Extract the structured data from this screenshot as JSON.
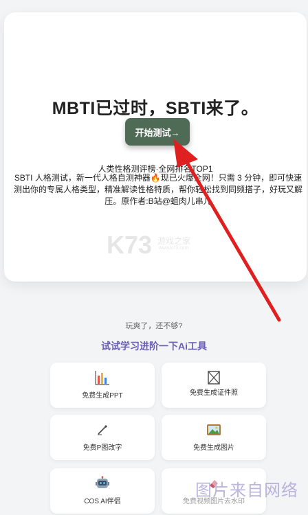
{
  "hero": {
    "title": "MBTI已过时，SBTI来了。",
    "start_button": "开始测试→",
    "subtitle": "人类性格测评榜·全网排名TOP1",
    "description": "SBTI 人格测试，新一代人格自测神器🔥现已火爆全网！只需 3 分钟，即可快速测出你的专属人格类型，精准解读性格特质，帮你轻松找到同频搭子，好玩又解压。原作者:B站@蛆肉儿串儿"
  },
  "watermark": {
    "logo": "K73",
    "site_name": "游戏之家",
    "url": "www.k73.com"
  },
  "more": {
    "hint": "玩爽了，还不够?",
    "title": "试试学习进阶一下Ai工具"
  },
  "tools": [
    {
      "label": "免费生成PPT",
      "icon": "bar-chart-icon"
    },
    {
      "label": "免费生成证件照",
      "icon": "id-photo-icon"
    },
    {
      "label": "免费P图改字",
      "icon": "pen-edit-icon"
    },
    {
      "label": "免费生成图片",
      "icon": "picture-icon"
    },
    {
      "label": "COS AI伴侣",
      "icon": "robot-icon"
    },
    {
      "label": "免费视频图片去水印",
      "icon": "eraser-icon"
    }
  ],
  "corner_watermark": "图片来自网络",
  "colors": {
    "button_bg": "#4f6b56",
    "section_title": "#6a5db8",
    "arrow": "#e02020"
  }
}
